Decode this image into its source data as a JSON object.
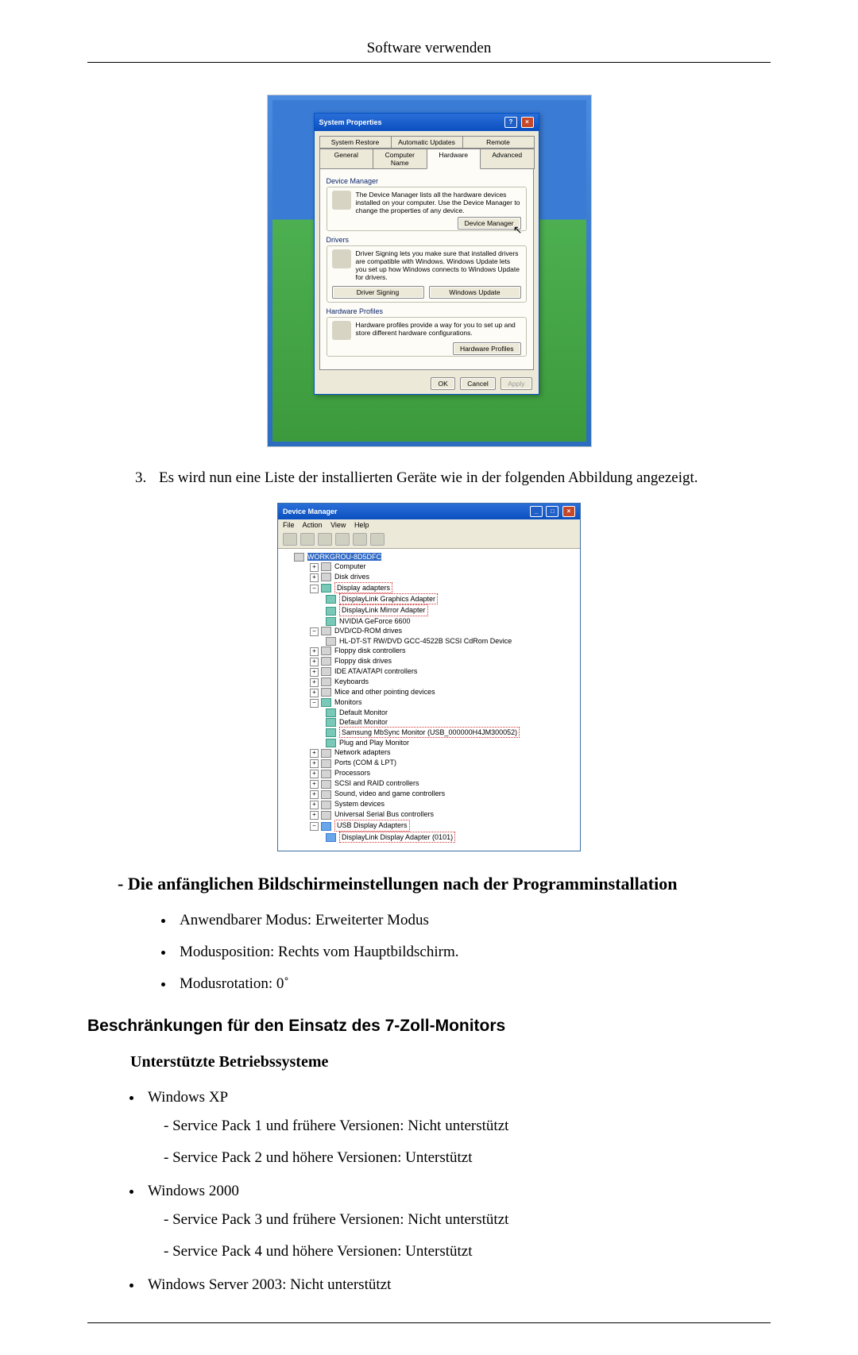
{
  "header": "Software verwenden",
  "sysprops": {
    "title": "System Properties",
    "tabs_top": [
      "System Restore",
      "Automatic Updates",
      "Remote"
    ],
    "tabs_bottom": [
      "General",
      "Computer Name",
      "Hardware",
      "Advanced"
    ],
    "groups": {
      "dm": {
        "label": "Device Manager",
        "text": "The Device Manager lists all the hardware devices installed on your computer. Use the Device Manager to change the properties of any device.",
        "button": "Device Manager"
      },
      "drv": {
        "label": "Drivers",
        "text": "Driver Signing lets you make sure that installed drivers are compatible with Windows. Windows Update lets you set up how Windows connects to Windows Update for drivers.",
        "button_left": "Driver Signing",
        "button_right": "Windows Update"
      },
      "hp": {
        "label": "Hardware Profiles",
        "text": "Hardware profiles provide a way for you to set up and store different hardware configurations.",
        "button": "Hardware Profiles"
      }
    },
    "footer": {
      "ok": "OK",
      "cancel": "Cancel",
      "apply": "Apply"
    }
  },
  "step3": {
    "num": "3.",
    "text": "Es wird nun eine Liste der installierten Geräte wie in der folgenden Abbildung angezeigt."
  },
  "devmgr": {
    "title": "Device Manager",
    "menu": [
      "File",
      "Action",
      "View",
      "Help"
    ],
    "root": "WORKGROU-8D5DFC",
    "items": [
      {
        "label": "Computer",
        "lvl": 2,
        "icon": "pc",
        "expand": "+"
      },
      {
        "label": "Disk drives",
        "lvl": 2,
        "icon": "pc",
        "expand": "+"
      },
      {
        "label": "Display adapters",
        "lvl": 2,
        "icon": "mon",
        "expand": "−",
        "hl": true
      },
      {
        "label": "DisplayLink Graphics Adapter",
        "lvl": 3,
        "icon": "mon",
        "hl": true
      },
      {
        "label": "DisplayLink Mirror Adapter",
        "lvl": 3,
        "icon": "mon",
        "hl": true
      },
      {
        "label": "NVIDIA GeForce 6600",
        "lvl": 3,
        "icon": "mon"
      },
      {
        "label": "DVD/CD-ROM drives",
        "lvl": 2,
        "icon": "pc",
        "expand": "−"
      },
      {
        "label": "HL-DT-ST RW/DVD GCC-4522B SCSI CdRom Device",
        "lvl": 3,
        "icon": "pc"
      },
      {
        "label": "Floppy disk controllers",
        "lvl": 2,
        "icon": "pc",
        "expand": "+"
      },
      {
        "label": "Floppy disk drives",
        "lvl": 2,
        "icon": "pc",
        "expand": "+"
      },
      {
        "label": "IDE ATA/ATAPI controllers",
        "lvl": 2,
        "icon": "pc",
        "expand": "+"
      },
      {
        "label": "Keyboards",
        "lvl": 2,
        "icon": "pc",
        "expand": "+"
      },
      {
        "label": "Mice and other pointing devices",
        "lvl": 2,
        "icon": "pc",
        "expand": "+"
      },
      {
        "label": "Monitors",
        "lvl": 2,
        "icon": "mon",
        "expand": "−"
      },
      {
        "label": "Default Monitor",
        "lvl": 3,
        "icon": "mon"
      },
      {
        "label": "Default Monitor",
        "lvl": 3,
        "icon": "mon"
      },
      {
        "label": "Samsung MbSync Monitor (USB_000000H4JM300052)",
        "lvl": 3,
        "icon": "mon",
        "hl": true
      },
      {
        "label": "Plug and Play Monitor",
        "lvl": 3,
        "icon": "mon"
      },
      {
        "label": "Network adapters",
        "lvl": 2,
        "icon": "pc",
        "expand": "+"
      },
      {
        "label": "Ports (COM & LPT)",
        "lvl": 2,
        "icon": "pc",
        "expand": "+"
      },
      {
        "label": "Processors",
        "lvl": 2,
        "icon": "pc",
        "expand": "+"
      },
      {
        "label": "SCSI and RAID controllers",
        "lvl": 2,
        "icon": "pc",
        "expand": "+"
      },
      {
        "label": "Sound, video and game controllers",
        "lvl": 2,
        "icon": "pc",
        "expand": "+"
      },
      {
        "label": "System devices",
        "lvl": 2,
        "icon": "pc",
        "expand": "+"
      },
      {
        "label": "Universal Serial Bus controllers",
        "lvl": 2,
        "icon": "pc",
        "expand": "+"
      },
      {
        "label": "USB Display Adapters",
        "lvl": 2,
        "icon": "blue",
        "expand": "−",
        "hl": true
      },
      {
        "label": "DisplayLink Display Adapter (0101)",
        "lvl": 3,
        "icon": "blue",
        "hl": true
      }
    ]
  },
  "sections": {
    "initial": "- Die anfänglichen Bildschirmeinstellungen nach der Programminstallation",
    "bullets": [
      "Anwendbarer Modus: Erweiterter Modus",
      "Modusposition: Rechts vom Hauptbildschirm.",
      "Modusrotation: 0˚"
    ],
    "limits": "Beschränkungen für den Einsatz des 7-Zoll-Monitors",
    "supported_os": "Unterstützte Betriebssysteme",
    "os": [
      {
        "name": "Windows XP",
        "sp": [
          "- Service Pack 1 und frühere Versionen: Nicht unterstützt",
          "- Service Pack 2 und höhere Versionen: Unterstützt"
        ]
      },
      {
        "name": "Windows 2000",
        "sp": [
          "- Service Pack 3 und frühere Versionen: Nicht unterstützt",
          "- Service Pack 4 und höhere Versionen: Unterstützt"
        ]
      },
      {
        "name": "Windows Server 2003: Nicht unterstützt",
        "sp": []
      }
    ]
  }
}
